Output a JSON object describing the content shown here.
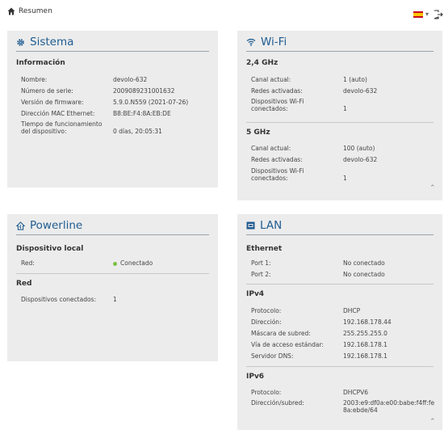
{
  "header": {
    "breadcrumb": "Resumen",
    "language": "es",
    "flag_colors": [
      "#c60b1e",
      "#ffc400"
    ]
  },
  "sistema": {
    "title": "Sistema",
    "section": "Información",
    "rows": [
      {
        "label": "Nombre:",
        "value": "devolo-632"
      },
      {
        "label": "Número de serie:",
        "value": "2009089231001632"
      },
      {
        "label": "Versión de firmware:",
        "value": "5.9.0.N559 (2021-07-26)"
      },
      {
        "label": "Dirección MAC Ethernet:",
        "value": "B8:BE:F4:8A:EB:DE"
      },
      {
        "label": "Tiempo de funcionamiento del dispositivo:",
        "value": "0 días, 20:05:31"
      }
    ]
  },
  "wifi": {
    "title": "Wi-Fi",
    "band24": {
      "section": "2,4 GHz",
      "rows": [
        {
          "label": "Canal actual:",
          "value": "1 (auto)"
        },
        {
          "label": "Redes activadas:",
          "value": "devolo-632"
        },
        {
          "label": "Dispositivos Wi-Fi conectados:",
          "value": "1"
        }
      ]
    },
    "band5": {
      "section": "5 GHz",
      "rows": [
        {
          "label": "Canal actual:",
          "value": "100 (auto)"
        },
        {
          "label": "Redes activadas:",
          "value": "devolo-632"
        },
        {
          "label": "Dispositivos Wi-Fi conectados:",
          "value": "1"
        }
      ]
    }
  },
  "powerline": {
    "title": "Powerline",
    "local": {
      "section": "Dispositivo local",
      "label": "Red:",
      "value": "Conectado",
      "status_color": "#7cc142"
    },
    "red": {
      "section": "Red",
      "label": "Dispositivos conectados:",
      "value": "1"
    }
  },
  "lan": {
    "title": "LAN",
    "ethernet": {
      "section": "Ethernet",
      "rows": [
        {
          "label": "Port 1:",
          "value": "No conectado"
        },
        {
          "label": "Port 2:",
          "value": "No conectado"
        }
      ]
    },
    "ipv4": {
      "section": "IPv4",
      "rows": [
        {
          "label": "Protocolo:",
          "value": "DHCP"
        },
        {
          "label": "Dirección:",
          "value": "192.168.178.44"
        },
        {
          "label": "Máscara de subred:",
          "value": "255.255.255.0"
        },
        {
          "label": "Vía de acceso estándar:",
          "value": "192.168.178.1"
        },
        {
          "label": "Servidor DNS:",
          "value": "192.168.178.1"
        }
      ]
    },
    "ipv6": {
      "section": "IPv6",
      "rows": [
        {
          "label": "Protocolo:",
          "value": "DHCPV6"
        },
        {
          "label": "Dirección/subred:",
          "value": "2003:e9:df0a:e00:babe:f4ff:fe8a:ebde/64"
        }
      ]
    }
  },
  "theme": {
    "accent": "#1f5c90",
    "card_bg": "#ececec"
  }
}
